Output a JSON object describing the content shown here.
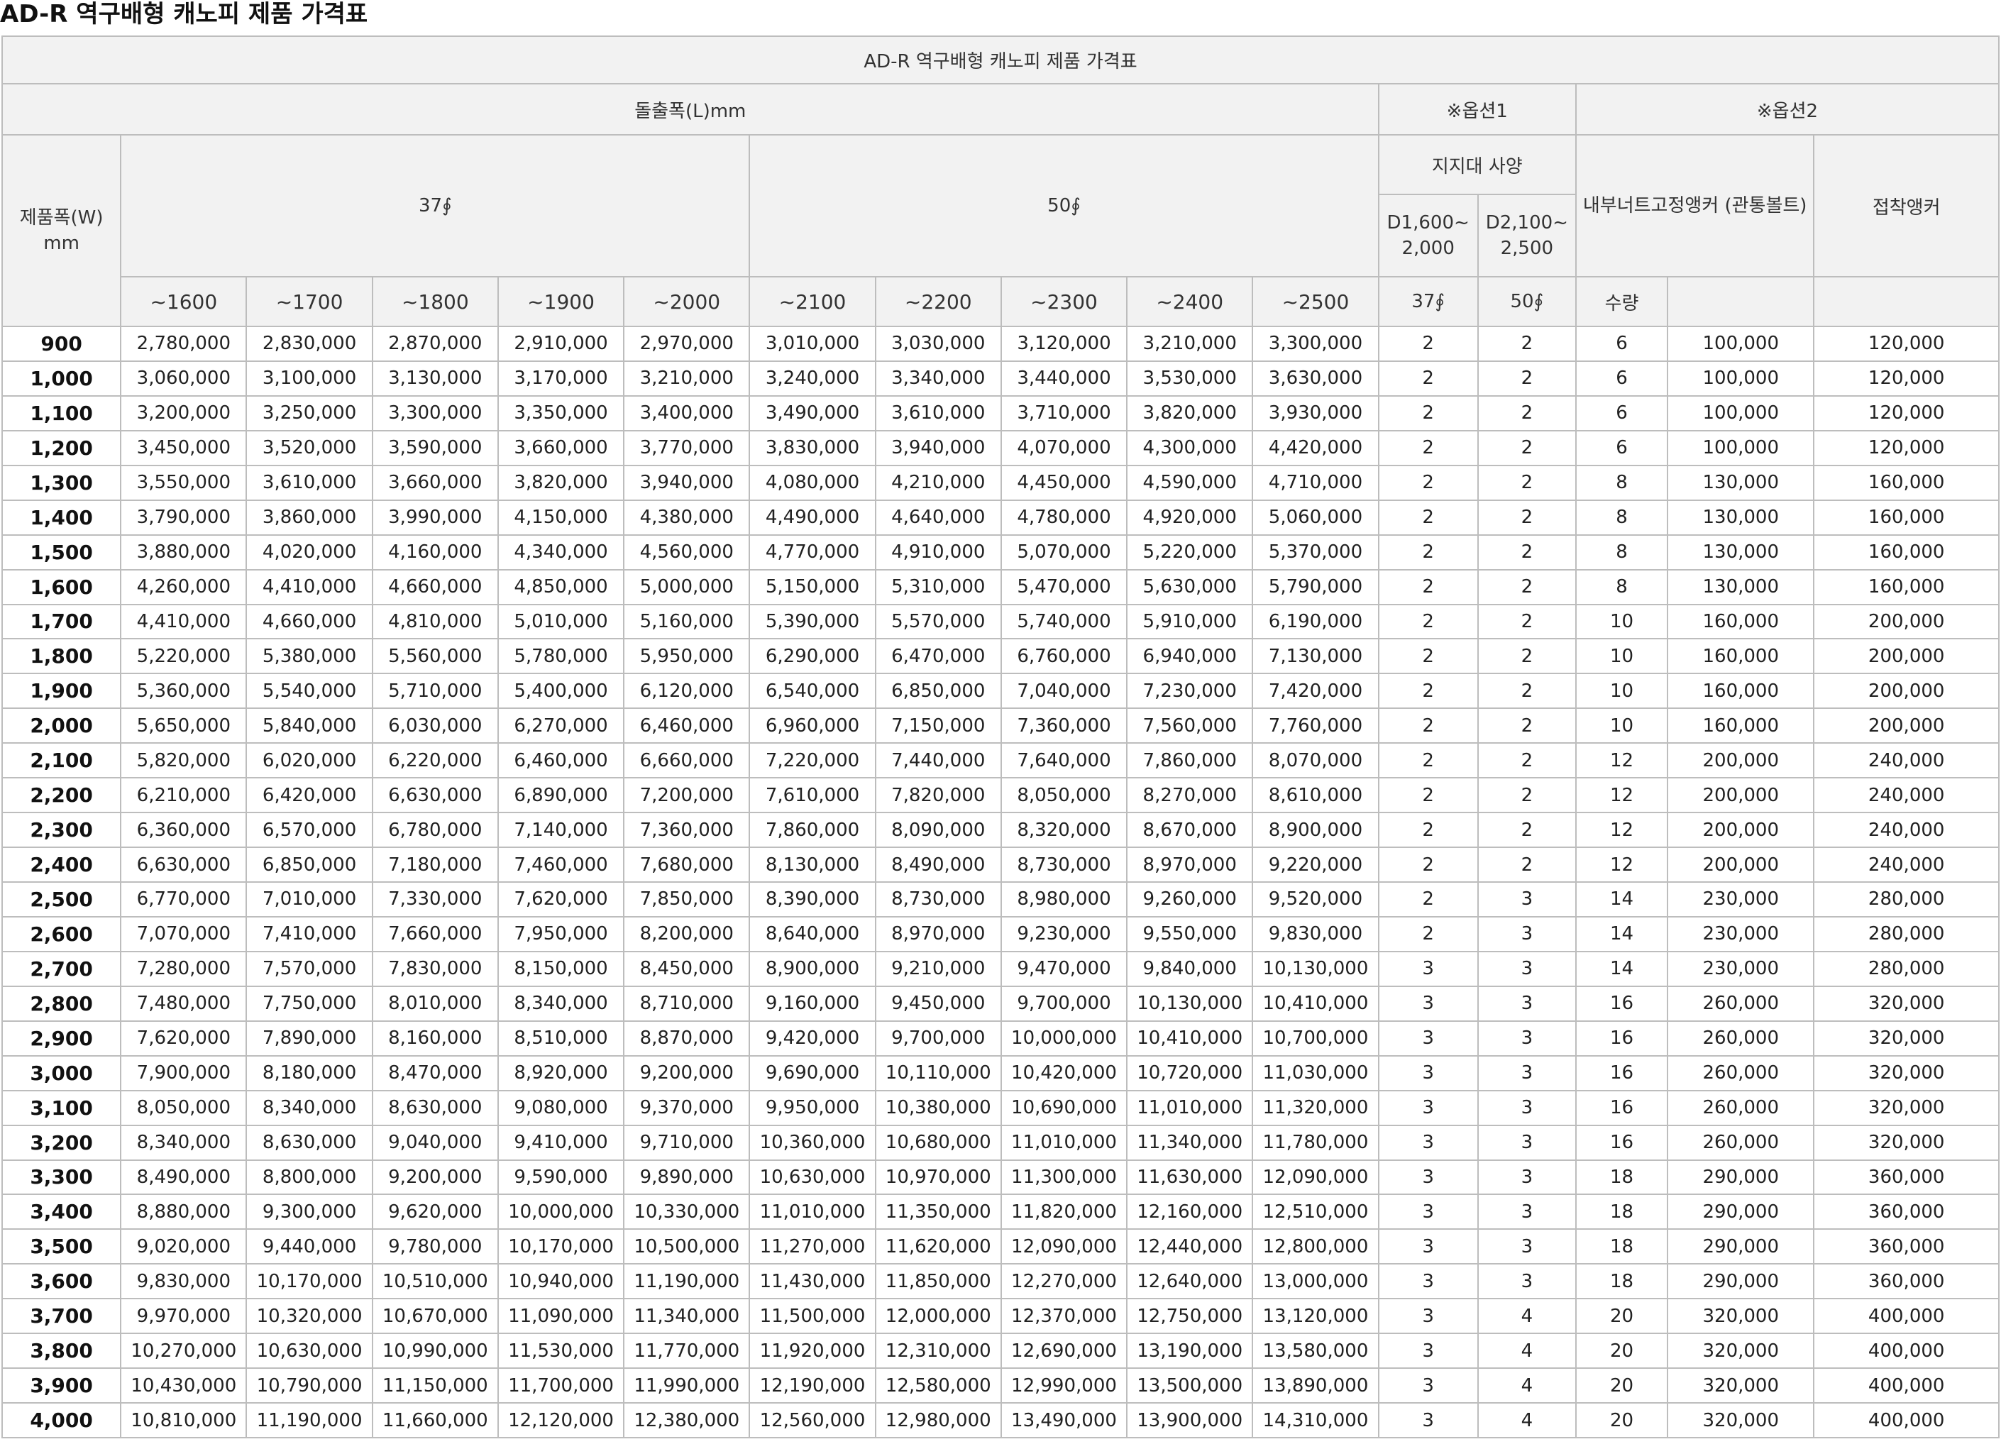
{
  "page_title": "AD-R 역구배형 캐노피 제품 가격표",
  "table": {
    "caption": "AD-R 역구배형 캐노피 제품 가격표",
    "projection_header": "돌출폭(L)mm",
    "option1_header": "※옵션1",
    "option2_header": "※옵션2",
    "width_header": "제품폭(W)\nmm",
    "group_37": "37∮",
    "group_50": "50∮",
    "support_spec": "지지대 사양",
    "d1600": "D1,600~\n2,000",
    "d2100": "D2,100~\n2,500",
    "inner_nut_anchor": "내부너트고정앵커\n(관통볼트)",
    "adhesive_anchor": "접착앵커",
    "sub_37": "37∮",
    "sub_50": "50∮",
    "qty": "수량",
    "sizes": [
      "~1600",
      "~1700",
      "~1800",
      "~1900",
      "~2000",
      "~2100",
      "~2200",
      "~2300",
      "~2400",
      "~2500"
    ],
    "rows": [
      [
        "900",
        "2,780,000",
        "2,830,000",
        "2,870,000",
        "2,910,000",
        "2,970,000",
        "3,010,000",
        "3,030,000",
        "3,120,000",
        "3,210,000",
        "3,300,000",
        "2",
        "2",
        "6",
        "100,000",
        "120,000"
      ],
      [
        "1,000",
        "3,060,000",
        "3,100,000",
        "3,130,000",
        "3,170,000",
        "3,210,000",
        "3,240,000",
        "3,340,000",
        "3,440,000",
        "3,530,000",
        "3,630,000",
        "2",
        "2",
        "6",
        "100,000",
        "120,000"
      ],
      [
        "1,100",
        "3,200,000",
        "3,250,000",
        "3,300,000",
        "3,350,000",
        "3,400,000",
        "3,490,000",
        "3,610,000",
        "3,710,000",
        "3,820,000",
        "3,930,000",
        "2",
        "2",
        "6",
        "100,000",
        "120,000"
      ],
      [
        "1,200",
        "3,450,000",
        "3,520,000",
        "3,590,000",
        "3,660,000",
        "3,770,000",
        "3,830,000",
        "3,940,000",
        "4,070,000",
        "4,300,000",
        "4,420,000",
        "2",
        "2",
        "6",
        "100,000",
        "120,000"
      ],
      [
        "1,300",
        "3,550,000",
        "3,610,000",
        "3,660,000",
        "3,820,000",
        "3,940,000",
        "4,080,000",
        "4,210,000",
        "4,450,000",
        "4,590,000",
        "4,710,000",
        "2",
        "2",
        "8",
        "130,000",
        "160,000"
      ],
      [
        "1,400",
        "3,790,000",
        "3,860,000",
        "3,990,000",
        "4,150,000",
        "4,380,000",
        "4,490,000",
        "4,640,000",
        "4,780,000",
        "4,920,000",
        "5,060,000",
        "2",
        "2",
        "8",
        "130,000",
        "160,000"
      ],
      [
        "1,500",
        "3,880,000",
        "4,020,000",
        "4,160,000",
        "4,340,000",
        "4,560,000",
        "4,770,000",
        "4,910,000",
        "5,070,000",
        "5,220,000",
        "5,370,000",
        "2",
        "2",
        "8",
        "130,000",
        "160,000"
      ],
      [
        "1,600",
        "4,260,000",
        "4,410,000",
        "4,660,000",
        "4,850,000",
        "5,000,000",
        "5,150,000",
        "5,310,000",
        "5,470,000",
        "5,630,000",
        "5,790,000",
        "2",
        "2",
        "8",
        "130,000",
        "160,000"
      ],
      [
        "1,700",
        "4,410,000",
        "4,660,000",
        "4,810,000",
        "5,010,000",
        "5,160,000",
        "5,390,000",
        "5,570,000",
        "5,740,000",
        "5,910,000",
        "6,190,000",
        "2",
        "2",
        "10",
        "160,000",
        "200,000"
      ],
      [
        "1,800",
        "5,220,000",
        "5,380,000",
        "5,560,000",
        "5,780,000",
        "5,950,000",
        "6,290,000",
        "6,470,000",
        "6,760,000",
        "6,940,000",
        "7,130,000",
        "2",
        "2",
        "10",
        "160,000",
        "200,000"
      ],
      [
        "1,900",
        "5,360,000",
        "5,540,000",
        "5,710,000",
        "5,400,000",
        "6,120,000",
        "6,540,000",
        "6,850,000",
        "7,040,000",
        "7,230,000",
        "7,420,000",
        "2",
        "2",
        "10",
        "160,000",
        "200,000"
      ],
      [
        "2,000",
        "5,650,000",
        "5,840,000",
        "6,030,000",
        "6,270,000",
        "6,460,000",
        "6,960,000",
        "7,150,000",
        "7,360,000",
        "7,560,000",
        "7,760,000",
        "2",
        "2",
        "10",
        "160,000",
        "200,000"
      ],
      [
        "2,100",
        "5,820,000",
        "6,020,000",
        "6,220,000",
        "6,460,000",
        "6,660,000",
        "7,220,000",
        "7,440,000",
        "7,640,000",
        "7,860,000",
        "8,070,000",
        "2",
        "2",
        "12",
        "200,000",
        "240,000"
      ],
      [
        "2,200",
        "6,210,000",
        "6,420,000",
        "6,630,000",
        "6,890,000",
        "7,200,000",
        "7,610,000",
        "7,820,000",
        "8,050,000",
        "8,270,000",
        "8,610,000",
        "2",
        "2",
        "12",
        "200,000",
        "240,000"
      ],
      [
        "2,300",
        "6,360,000",
        "6,570,000",
        "6,780,000",
        "7,140,000",
        "7,360,000",
        "7,860,000",
        "8,090,000",
        "8,320,000",
        "8,670,000",
        "8,900,000",
        "2",
        "2",
        "12",
        "200,000",
        "240,000"
      ],
      [
        "2,400",
        "6,630,000",
        "6,850,000",
        "7,180,000",
        "7,460,000",
        "7,680,000",
        "8,130,000",
        "8,490,000",
        "8,730,000",
        "8,970,000",
        "9,220,000",
        "2",
        "2",
        "12",
        "200,000",
        "240,000"
      ],
      [
        "2,500",
        "6,770,000",
        "7,010,000",
        "7,330,000",
        "7,620,000",
        "7,850,000",
        "8,390,000",
        "8,730,000",
        "8,980,000",
        "9,260,000",
        "9,520,000",
        "2",
        "3",
        "14",
        "230,000",
        "280,000"
      ],
      [
        "2,600",
        "7,070,000",
        "7,410,000",
        "7,660,000",
        "7,950,000",
        "8,200,000",
        "8,640,000",
        "8,970,000",
        "9,230,000",
        "9,550,000",
        "9,830,000",
        "2",
        "3",
        "14",
        "230,000",
        "280,000"
      ],
      [
        "2,700",
        "7,280,000",
        "7,570,000",
        "7,830,000",
        "8,150,000",
        "8,450,000",
        "8,900,000",
        "9,210,000",
        "9,470,000",
        "9,840,000",
        "10,130,000",
        "3",
        "3",
        "14",
        "230,000",
        "280,000"
      ],
      [
        "2,800",
        "7,480,000",
        "7,750,000",
        "8,010,000",
        "8,340,000",
        "8,710,000",
        "9,160,000",
        "9,450,000",
        "9,700,000",
        "10,130,000",
        "10,410,000",
        "3",
        "3",
        "16",
        "260,000",
        "320,000"
      ],
      [
        "2,900",
        "7,620,000",
        "7,890,000",
        "8,160,000",
        "8,510,000",
        "8,870,000",
        "9,420,000",
        "9,700,000",
        "10,000,000",
        "10,410,000",
        "10,700,000",
        "3",
        "3",
        "16",
        "260,000",
        "320,000"
      ],
      [
        "3,000",
        "7,900,000",
        "8,180,000",
        "8,470,000",
        "8,920,000",
        "9,200,000",
        "9,690,000",
        "10,110,000",
        "10,420,000",
        "10,720,000",
        "11,030,000",
        "3",
        "3",
        "16",
        "260,000",
        "320,000"
      ],
      [
        "3,100",
        "8,050,000",
        "8,340,000",
        "8,630,000",
        "9,080,000",
        "9,370,000",
        "9,950,000",
        "10,380,000",
        "10,690,000",
        "11,010,000",
        "11,320,000",
        "3",
        "3",
        "16",
        "260,000",
        "320,000"
      ],
      [
        "3,200",
        "8,340,000",
        "8,630,000",
        "9,040,000",
        "9,410,000",
        "9,710,000",
        "10,360,000",
        "10,680,000",
        "11,010,000",
        "11,340,000",
        "11,780,000",
        "3",
        "3",
        "16",
        "260,000",
        "320,000"
      ],
      [
        "3,300",
        "8,490,000",
        "8,800,000",
        "9,200,000",
        "9,590,000",
        "9,890,000",
        "10,630,000",
        "10,970,000",
        "11,300,000",
        "11,630,000",
        "12,090,000",
        "3",
        "3",
        "18",
        "290,000",
        "360,000"
      ],
      [
        "3,400",
        "8,880,000",
        "9,300,000",
        "9,620,000",
        "10,000,000",
        "10,330,000",
        "11,010,000",
        "11,350,000",
        "11,820,000",
        "12,160,000",
        "12,510,000",
        "3",
        "3",
        "18",
        "290,000",
        "360,000"
      ],
      [
        "3,500",
        "9,020,000",
        "9,440,000",
        "9,780,000",
        "10,170,000",
        "10,500,000",
        "11,270,000",
        "11,620,000",
        "12,090,000",
        "12,440,000",
        "12,800,000",
        "3",
        "3",
        "18",
        "290,000",
        "360,000"
      ],
      [
        "3,600",
        "9,830,000",
        "10,170,000",
        "10,510,000",
        "10,940,000",
        "11,190,000",
        "11,430,000",
        "11,850,000",
        "12,270,000",
        "12,640,000",
        "13,000,000",
        "3",
        "3",
        "18",
        "290,000",
        "360,000"
      ],
      [
        "3,700",
        "9,970,000",
        "10,320,000",
        "10,670,000",
        "11,090,000",
        "11,340,000",
        "11,500,000",
        "12,000,000",
        "12,370,000",
        "12,750,000",
        "13,120,000",
        "3",
        "4",
        "20",
        "320,000",
        "400,000"
      ],
      [
        "3,800",
        "10,270,000",
        "10,630,000",
        "10,990,000",
        "11,530,000",
        "11,770,000",
        "11,920,000",
        "12,310,000",
        "12,690,000",
        "13,190,000",
        "13,580,000",
        "3",
        "4",
        "20",
        "320,000",
        "400,000"
      ],
      [
        "3,900",
        "10,430,000",
        "10,790,000",
        "11,150,000",
        "11,700,000",
        "11,990,000",
        "12,190,000",
        "12,580,000",
        "12,990,000",
        "13,500,000",
        "13,890,000",
        "3",
        "4",
        "20",
        "320,000",
        "400,000"
      ],
      [
        "4,000",
        "10,810,000",
        "11,190,000",
        "11,660,000",
        "12,120,000",
        "12,380,000",
        "12,560,000",
        "12,980,000",
        "13,490,000",
        "13,900,000",
        "14,310,000",
        "3",
        "4",
        "20",
        "320,000",
        "400,000"
      ]
    ]
  }
}
